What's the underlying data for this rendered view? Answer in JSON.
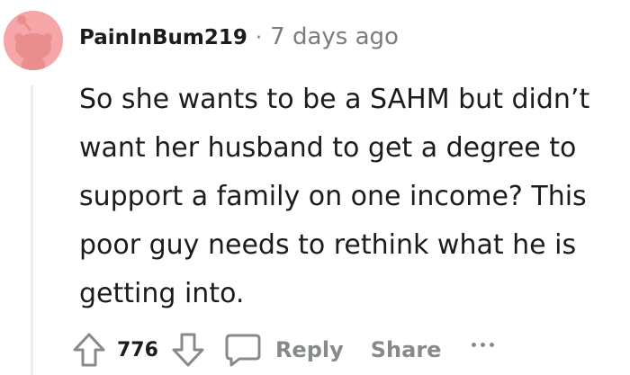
{
  "comment": {
    "username": "PainInBum219",
    "separator": "·",
    "timestamp": "7 days ago",
    "body": "So she wants to be a SAHM but didn’t want her husband to get a degree to support a family on one income? This poor guy needs to rethink what he is getting into."
  },
  "actions": {
    "score": "776",
    "reply_label": "Reply",
    "share_label": "Share"
  },
  "icons": {
    "avatar": "snoo-avatar-icon",
    "upvote": "upvote-arrow-icon",
    "downvote": "downvote-arrow-icon",
    "reply": "comment-bubble-icon",
    "more": "more-dots-icon"
  },
  "colors": {
    "avatar_bg": "#f6a6a6",
    "text": "#1c1c1c",
    "muted": "#878a8c",
    "thread_line": "#ededed"
  }
}
